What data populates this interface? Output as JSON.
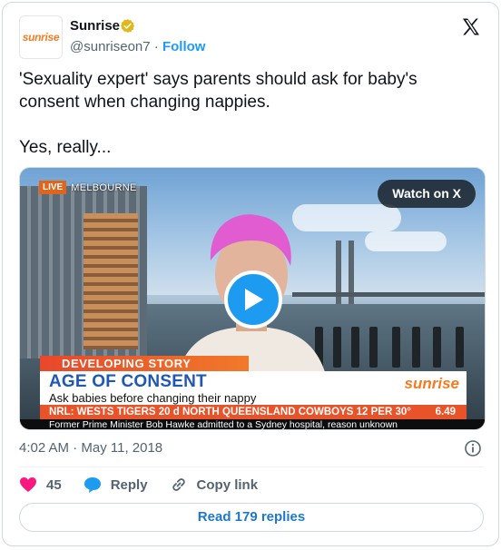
{
  "author": {
    "name": "Sunrise",
    "handle": "@sunriseon7",
    "separator": "·",
    "follow_label": "Follow",
    "avatar_text": "sunrise",
    "verified_color": "#e2b719"
  },
  "platform_icon": "x-logo-icon",
  "tweet": {
    "text": "'Sexuality expert' says parents should ask for baby's consent when changing nappies.\n\nYes, really..."
  },
  "media": {
    "watch_label": "Watch on X",
    "live_label": "LIVE",
    "location": "MELBOURNE",
    "play_icon": "play-icon",
    "developing_label": "DEVELOPING STORY",
    "headline": "AGE OF CONSENT",
    "subhead": "Ask babies before changing their nappy",
    "brand": "sunrise",
    "ticker": "NRL: WESTS TIGERS 20 d NORTH QUEENSLAND COWBOYS 12     PER 30°",
    "ticker_time": "6.49",
    "crawl": "Former Prime Minister Bob Hawke admitted to a Sydney hospital, reason unknown"
  },
  "meta": {
    "timestamp": "4:02 AM · May 11, 2018",
    "info_icon": "info-icon"
  },
  "actions": {
    "like_count": "45",
    "reply_label": "Reply",
    "copy_label": "Copy link"
  },
  "read_replies_label": "Read 179 replies",
  "colors": {
    "accent": "#1d9bf0",
    "like": "#f91880",
    "text_secondary": "#536471"
  }
}
